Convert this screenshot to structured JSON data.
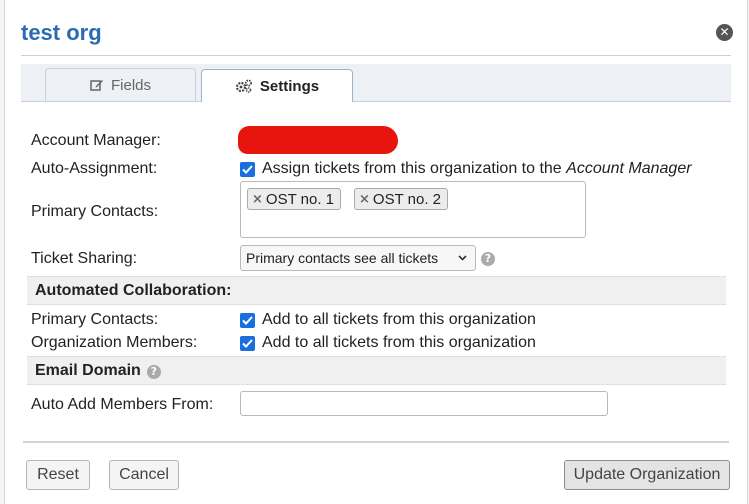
{
  "dialog": {
    "title": "test org"
  },
  "tabs": [
    {
      "label": "Fields",
      "icon": "edit-icon"
    },
    {
      "label": "Settings",
      "icon": "gears-icon",
      "active": true
    }
  ],
  "form": {
    "account_manager": {
      "label": "Account Manager:"
    },
    "auto_assignment": {
      "label": "Auto-Assignment:",
      "checked": true,
      "text": "Assign tickets from this organization to the ",
      "text_em": "Account Manager"
    },
    "primary_contacts": {
      "label": "Primary Contacts:",
      "chips": [
        "OST no. 1",
        "OST no. 2"
      ]
    },
    "ticket_sharing": {
      "label": "Ticket Sharing:",
      "selected": "Primary contacts see all tickets"
    }
  },
  "collab": {
    "heading": "Automated Collaboration:",
    "primary_contacts": {
      "label": "Primary Contacts:",
      "text": "Add to all tickets from this organization",
      "checked": true
    },
    "org_members": {
      "label": "Organization Members:",
      "text": "Add to all tickets from this organization",
      "checked": true
    }
  },
  "email_domain": {
    "heading": "Email Domain",
    "auto_add": {
      "label": "Auto Add Members From:",
      "value": ""
    }
  },
  "buttons": {
    "reset": "Reset",
    "cancel": "Cancel",
    "update": "Update Organization"
  },
  "colors": {
    "title": "#2b6cb0",
    "checkbox": "#1a6fe0",
    "redaction": "#e8150f"
  }
}
